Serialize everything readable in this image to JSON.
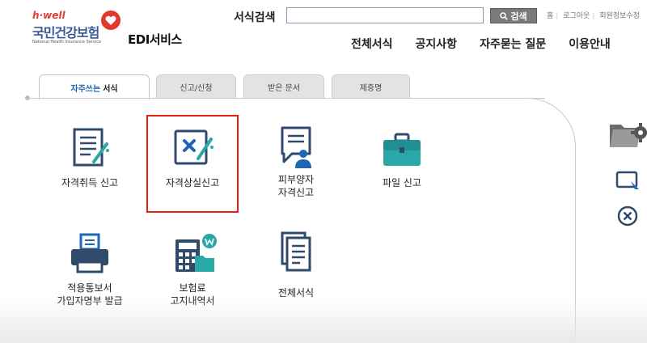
{
  "header": {
    "logo_tagline": "h·well",
    "logo_name": "국민건강보험",
    "logo_english": "National Health Insurance Service",
    "service_name": "EDI서비스",
    "search_label": "서식검색",
    "search_value": "",
    "search_button": "검색",
    "util_links": [
      "홈",
      "로그아웃",
      "회원정보수정"
    ],
    "nav": [
      "전체서식",
      "공지사항",
      "자주묻는 질문",
      "이용안내"
    ]
  },
  "tabs": [
    {
      "label": "자주쓰는",
      "label_em": "서식",
      "active": true
    },
    {
      "label": "신고/신청",
      "active": false
    },
    {
      "label": "받은 문서",
      "active": false
    },
    {
      "label": "제증명",
      "active": false
    }
  ],
  "menu": [
    {
      "label": "자격취득 신고",
      "icon": "document-pen-icon"
    },
    {
      "label": "자격상실신고",
      "icon": "document-x-icon",
      "highlighted": true
    },
    {
      "label": "피부양자\n자격신고",
      "icon": "speech-person-icon"
    },
    {
      "label": "파일 신고",
      "icon": "briefcase-icon"
    },
    {
      "label": "적용통보서\n가입자명부 발급",
      "icon": "printer-icon"
    },
    {
      "label": "보험료\n고지내역서",
      "icon": "calculator-folder-icon"
    },
    {
      "label": "전체서식",
      "icon": "documents-stack-icon"
    }
  ],
  "colors": {
    "accent": "#1f66b3",
    "highlight_border": "#e2231a",
    "icon_navy": "#2f4a6b",
    "icon_teal": "#2aa7a7"
  }
}
